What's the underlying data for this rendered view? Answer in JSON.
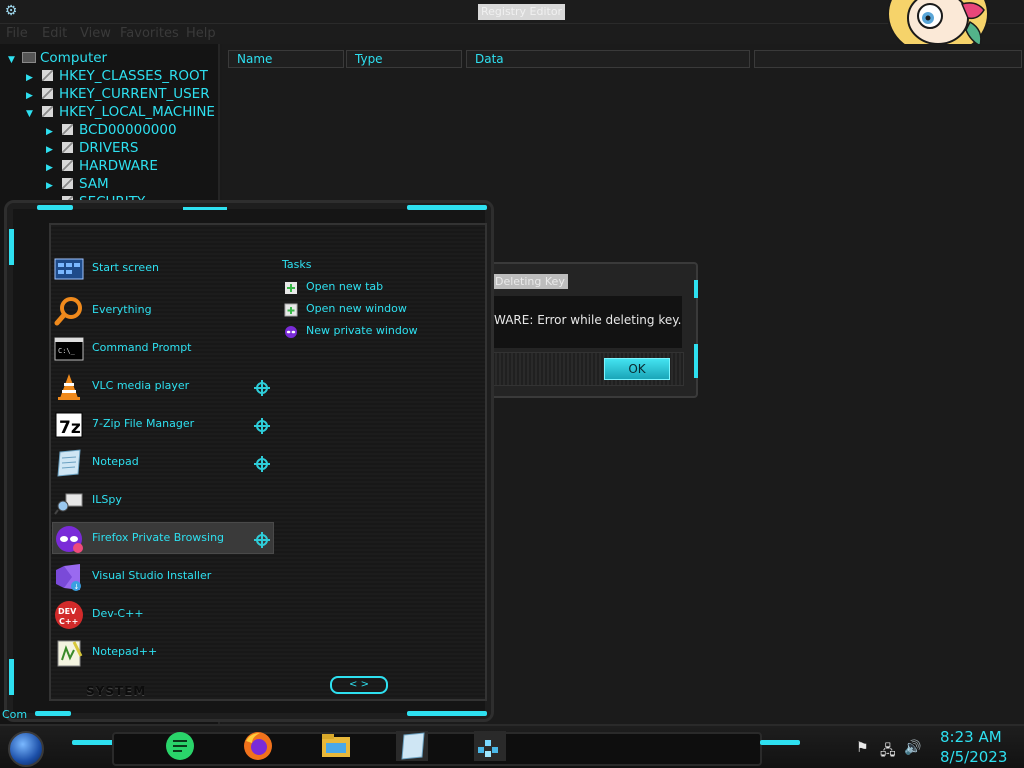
{
  "window": {
    "title": "Registry Editor"
  },
  "menubar": [
    "File",
    "Edit",
    "View",
    "Favorites",
    "Help"
  ],
  "tree": [
    {
      "label": "Computer",
      "level": 0,
      "type": "computer"
    },
    {
      "label": "HKEY_CLASSES_ROOT",
      "level": 1,
      "type": "hive"
    },
    {
      "label": "HKEY_CURRENT_USER",
      "level": 1,
      "type": "hive"
    },
    {
      "label": "HKEY_LOCAL_MACHINE",
      "level": 1,
      "type": "hive"
    },
    {
      "label": "BCD00000000",
      "level": 2,
      "type": "key"
    },
    {
      "label": "DRIVERS",
      "level": 2,
      "type": "key"
    },
    {
      "label": "HARDWARE",
      "level": 2,
      "type": "key"
    },
    {
      "label": "SAM",
      "level": 2,
      "type": "key"
    },
    {
      "label": "SECURITY",
      "level": 2,
      "type": "key"
    }
  ],
  "columns": [
    "Name",
    "Type",
    "Data"
  ],
  "error_dialog": {
    "title": "Deleting Key",
    "message": "WARE:  Error while deleting key.",
    "ok_label": "OK"
  },
  "start_menu": {
    "apps": [
      {
        "label": "Start screen",
        "icon": "start-screen-icon",
        "pinned": false
      },
      {
        "label": "Everything",
        "icon": "search-icon",
        "pinned": false
      },
      {
        "label": "Command Prompt",
        "icon": "terminal-icon",
        "pinned": false
      },
      {
        "label": "VLC media player",
        "icon": "vlc-cone-icon",
        "pinned": true
      },
      {
        "label": "7-Zip File Manager",
        "icon": "7zip-icon",
        "pinned": true
      },
      {
        "label": "Notepad",
        "icon": "notepad-icon",
        "pinned": true
      },
      {
        "label": "ILSpy",
        "icon": "ilspy-icon",
        "pinned": false
      },
      {
        "label": "Firefox Private Browsing",
        "icon": "private-browsing-icon",
        "pinned": true
      },
      {
        "label": "Visual Studio Installer",
        "icon": "visual-studio-icon",
        "pinned": false
      },
      {
        "label": "Dev-C++",
        "icon": "devcpp-icon",
        "pinned": false
      },
      {
        "label": "Notepad++",
        "icon": "notepadpp-icon",
        "pinned": false
      }
    ],
    "tasks_heading": "Tasks",
    "tasks": [
      {
        "label": "Open new tab",
        "icon": "new-tab-icon"
      },
      {
        "label": "Open new window",
        "icon": "new-window-icon"
      },
      {
        "label": "New private window",
        "icon": "private-window-icon"
      }
    ],
    "system_label": "SYSTEM",
    "nav_arrows": "< >"
  },
  "status_text": "Com",
  "taskbar": {
    "apps": [
      "notes-icon",
      "firefox-icon",
      "file-explorer-icon",
      "notepad-icon",
      "regedit-icon"
    ],
    "tray": {
      "flag": "⚑",
      "network": "🖧",
      "volume": "🔊"
    },
    "time": "8:23 AM",
    "date": "8/5/2023"
  },
  "colors": {
    "accent": "#2ee0f0",
    "background": "#161616"
  }
}
